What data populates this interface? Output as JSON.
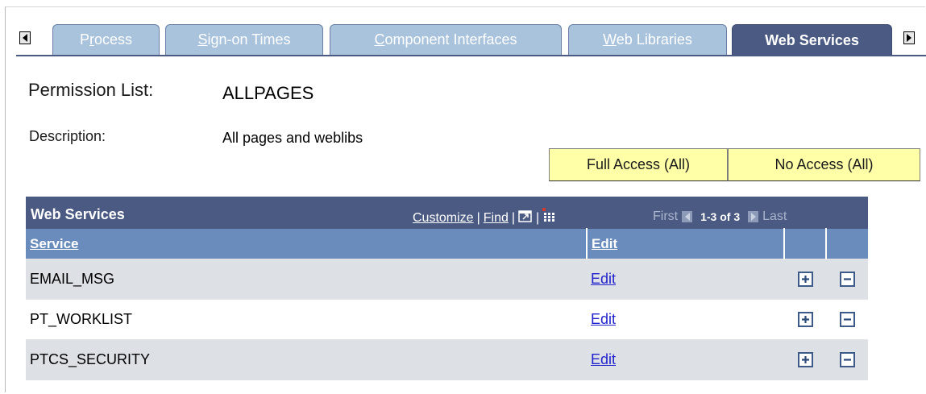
{
  "tabs": [
    {
      "label": "Process",
      "pre": "P",
      "key": "r",
      "post": "ocess",
      "active": false
    },
    {
      "label": "Sign-on Times",
      "pre": "",
      "key": "S",
      "post": "ign-on Times",
      "active": false
    },
    {
      "label": "Component Interfaces",
      "pre": "",
      "key": "C",
      "post": "omponent Interfaces",
      "active": false
    },
    {
      "label": "Web Libraries",
      "pre": "",
      "key": "W",
      "post": "eb Libraries",
      "active": false
    },
    {
      "label": "Web Services",
      "pre": "Web Services",
      "key": "",
      "post": "",
      "active": true
    }
  ],
  "permission_list": {
    "label": "Permission List:",
    "value": "ALLPAGES"
  },
  "description": {
    "label": "Description:",
    "value": "All pages and weblibs"
  },
  "actions": {
    "full_access": "Full Access (All)",
    "no_access": "No Access (All)"
  },
  "grid": {
    "title": "Web Services",
    "tools": {
      "customize": "Customize",
      "find": "Find",
      "sep": "|"
    },
    "pager": {
      "first": "First",
      "count": "1-3 of 3",
      "last": "Last"
    },
    "columns": {
      "service": "Service",
      "edit": "Edit"
    },
    "rows": [
      {
        "service": "EMAIL_MSG",
        "edit": "Edit"
      },
      {
        "service": "PT_WORKLIST",
        "edit": "Edit"
      },
      {
        "service": "PTCS_SECURITY",
        "edit": "Edit"
      }
    ]
  },
  "colors": {
    "tab_inactive": "#a9c3dc",
    "tab_active": "#4b5a82",
    "grid_header": "#4b5a82",
    "column_header": "#6a8cbd",
    "button_bg": "#ffffa8",
    "link": "#2222cc"
  },
  "icons": [
    "scroll-left-icon",
    "scroll-right-icon",
    "new-window-icon",
    "download-grid-icon",
    "first-arrow-icon",
    "last-arrow-icon",
    "add-row-icon",
    "delete-row-icon"
  ]
}
